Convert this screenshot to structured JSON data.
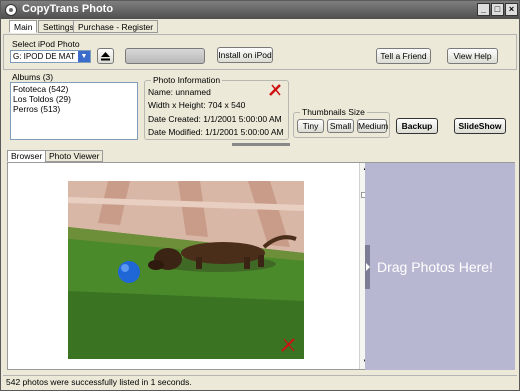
{
  "window": {
    "title": "CopyTrans Photo",
    "controls": {
      "minimize": "_",
      "maximize": "□",
      "close": "×"
    }
  },
  "menu": {
    "tabs": [
      "Main",
      "Settings",
      "Purchase - Register"
    ],
    "active": "Main"
  },
  "toolbar": {
    "select_ipod_label": "Select iPod Photo",
    "ipod_value": "G: IPOD DE MAT",
    "install_label": "Install on iPod",
    "tell_friend_label": "Tell a Friend",
    "view_help_label": "View Help",
    "eject_icon": "eject-icon"
  },
  "albums": {
    "label": "Albums (3)",
    "items": [
      "Fototeca (542)",
      "Los Toldos (29)",
      "Perros (513)"
    ]
  },
  "photo_info": {
    "title": "Photo Information",
    "name": "Name: unnamed",
    "size": "Width x Height: 704 x 540",
    "created": "Date Created: 1/1/2001 5:00:00 AM",
    "modified": "Date Modified: 1/1/2001 5:00:00 AM"
  },
  "thumbnails": {
    "title": "Thumbnails Size",
    "tiny": "Tiny",
    "small": "Small",
    "medium": "Medium"
  },
  "actions": {
    "backup": "Backup",
    "slideshow": "SlideShow"
  },
  "view_tabs": [
    "Browser",
    "Photo Viewer"
  ],
  "drop_zone": {
    "text": "Drag Photos Here!",
    "color": "#b7b7d2"
  },
  "status": "542 photos were successfully listed in 1 seconds."
}
